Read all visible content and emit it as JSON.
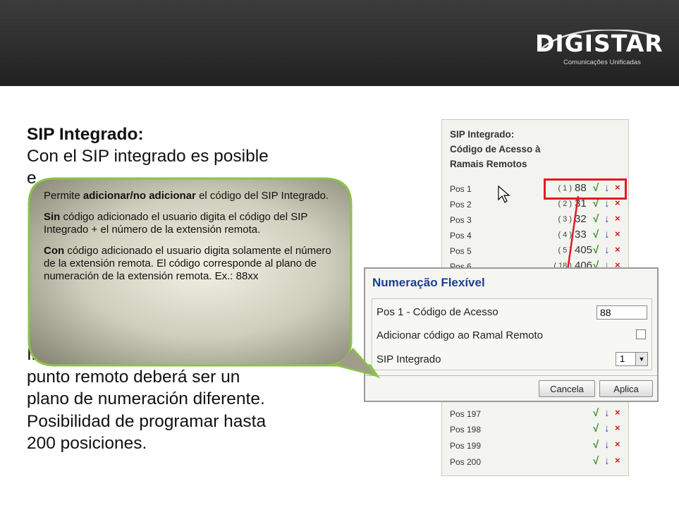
{
  "brand": {
    "name": "DIGISTAR",
    "tagline": "Comunicações Unificadas"
  },
  "slide": {
    "title": "SIP Integrado:",
    "intro_line1": "Con el SIP integrado es posible",
    "intro_line2_partial": "e",
    "bottom_partial": "In",
    "bottom_lines": [
      "punto remoto deberá ser un",
      "plano de numeración diferente.",
      "Posibilidad de programar hasta",
      "200 posiciones."
    ]
  },
  "callout": {
    "p1_pre": "Permite ",
    "p1_bold": "adicionar/no adicionar",
    "p1_post": " el código del SIP Integrado.",
    "p2_bold": "Sin",
    "p2_post": " código adicionado el usuario digita el código del SIP Integrado + el número de la extensión remota.",
    "p3_bold": "Con",
    "p3_post": " código adicionado el usuario digita solamente el número de la extensión remota. El código corresponde al plano de numeración de la extensión remota. Ex.: 88xx"
  },
  "sip_panel": {
    "title_l1": "SIP Integrado:",
    "title_l2": "Código de Acesso à",
    "title_l3": "Ramais Remotos",
    "rows_top": [
      {
        "label": "Pos 1",
        "num": "( 1 )",
        "value": "88"
      },
      {
        "label": "Pos 2",
        "num": "( 2 )",
        "value": "31"
      },
      {
        "label": "Pos 3",
        "num": "( 3 )",
        "value": "32"
      },
      {
        "label": "Pos 4",
        "num": "( 4 )",
        "value": "33"
      },
      {
        "label": "Pos 5",
        "num": "( 5 )",
        "value": "405"
      },
      {
        "label": "Pos 6",
        "num": "( 18 )",
        "value": "406"
      }
    ],
    "rows_bottom": [
      {
        "label": "Pos 197"
      },
      {
        "label": "Pos 198"
      },
      {
        "label": "Pos 199"
      },
      {
        "label": "Pos 200"
      }
    ],
    "icons": {
      "check": "√",
      "down": "↓",
      "delete": "×"
    }
  },
  "dialog": {
    "title": "Numeração Flexível",
    "field1_label": "Pos 1 - Código de Acesso",
    "field1_value": "88",
    "field2_label": "Adicionar código ao Ramal Remoto",
    "field2_checked": false,
    "field3_label": "SIP Integrado",
    "field3_value": "1",
    "cancel_label": "Cancela",
    "apply_label": "Aplica"
  }
}
